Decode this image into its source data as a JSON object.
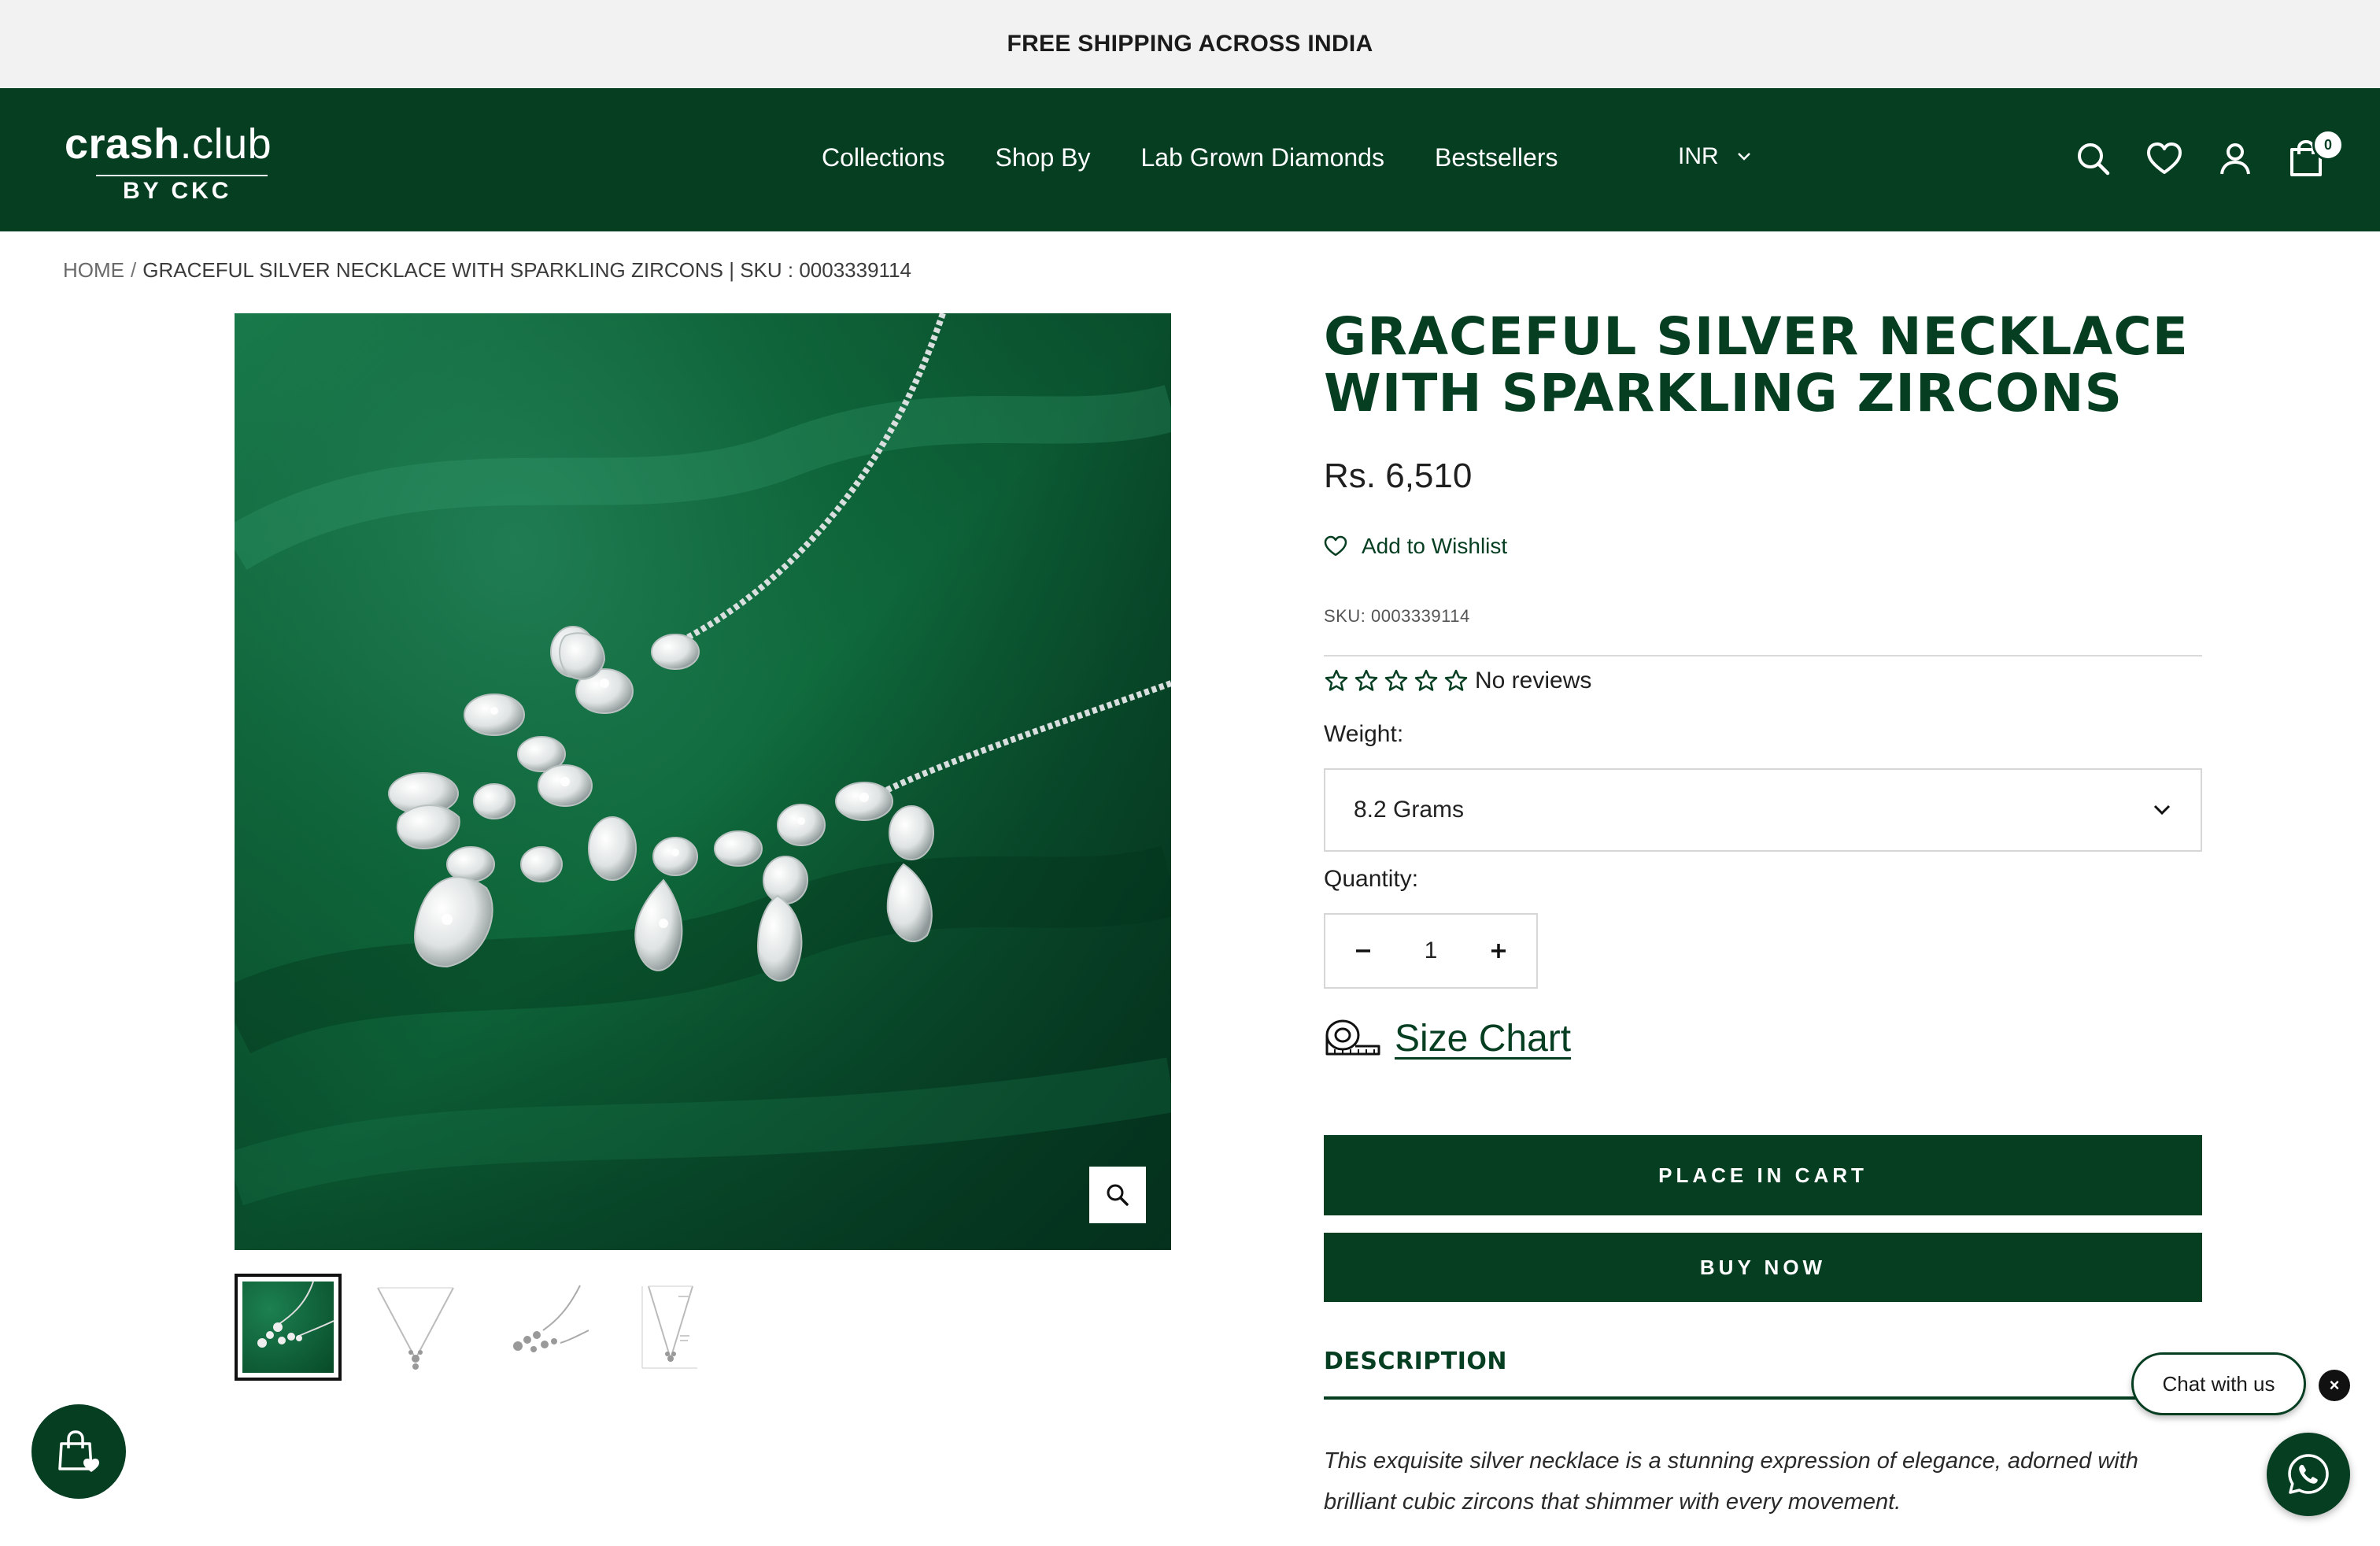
{
  "announcement": {
    "text": "FREE SHIPPING ACROSS INDIA"
  },
  "header": {
    "logo": {
      "word_bold": "crash",
      "word_light": ".club",
      "tagline": "BY CKC"
    },
    "nav": [
      {
        "label": "Collections"
      },
      {
        "label": "Shop By"
      },
      {
        "label": "Lab Grown Diamonds"
      },
      {
        "label": "Bestsellers"
      }
    ],
    "currency": "INR",
    "cart_count": "0",
    "icons": [
      "search-icon",
      "heart-icon",
      "user-icon",
      "cart-icon"
    ]
  },
  "breadcrumb": {
    "home": "HOME",
    "separator": "/",
    "current": "GRACEFUL SILVER NECKLACE WITH SPARKLING ZIRCONS | SKU : 0003339114"
  },
  "gallery": {
    "thumbnail_count": 4,
    "active_index": 0
  },
  "product": {
    "title": "GRACEFUL SILVER NECKLACE WITH SPARKLING ZIRCONS",
    "price": "Rs. 6,510",
    "wishlist_label": "Add to Wishlist",
    "sku": "SKU: 0003339114",
    "rating_stars": 0,
    "rating_max": 5,
    "reviews_label": "No reviews",
    "weight_label": "Weight:",
    "weight_value": "8.2 Grams",
    "quantity_label": "Quantity:",
    "quantity_value": "1",
    "size_chart_label": "Size Chart",
    "add_to_cart_label": "PLACE IN CART",
    "buy_now_label": "BUY NOW",
    "description_heading": "DESCRIPTION",
    "description_text": "This exquisite silver necklace is a stunning expression of elegance, adorned with brilliant cubic zircons that shimmer with every movement."
  },
  "chat": {
    "bubble_label": "Chat with us",
    "close_label": "×"
  },
  "colors": {
    "brand_green": "#063e22",
    "announcement_bg": "#f1f2f1"
  }
}
